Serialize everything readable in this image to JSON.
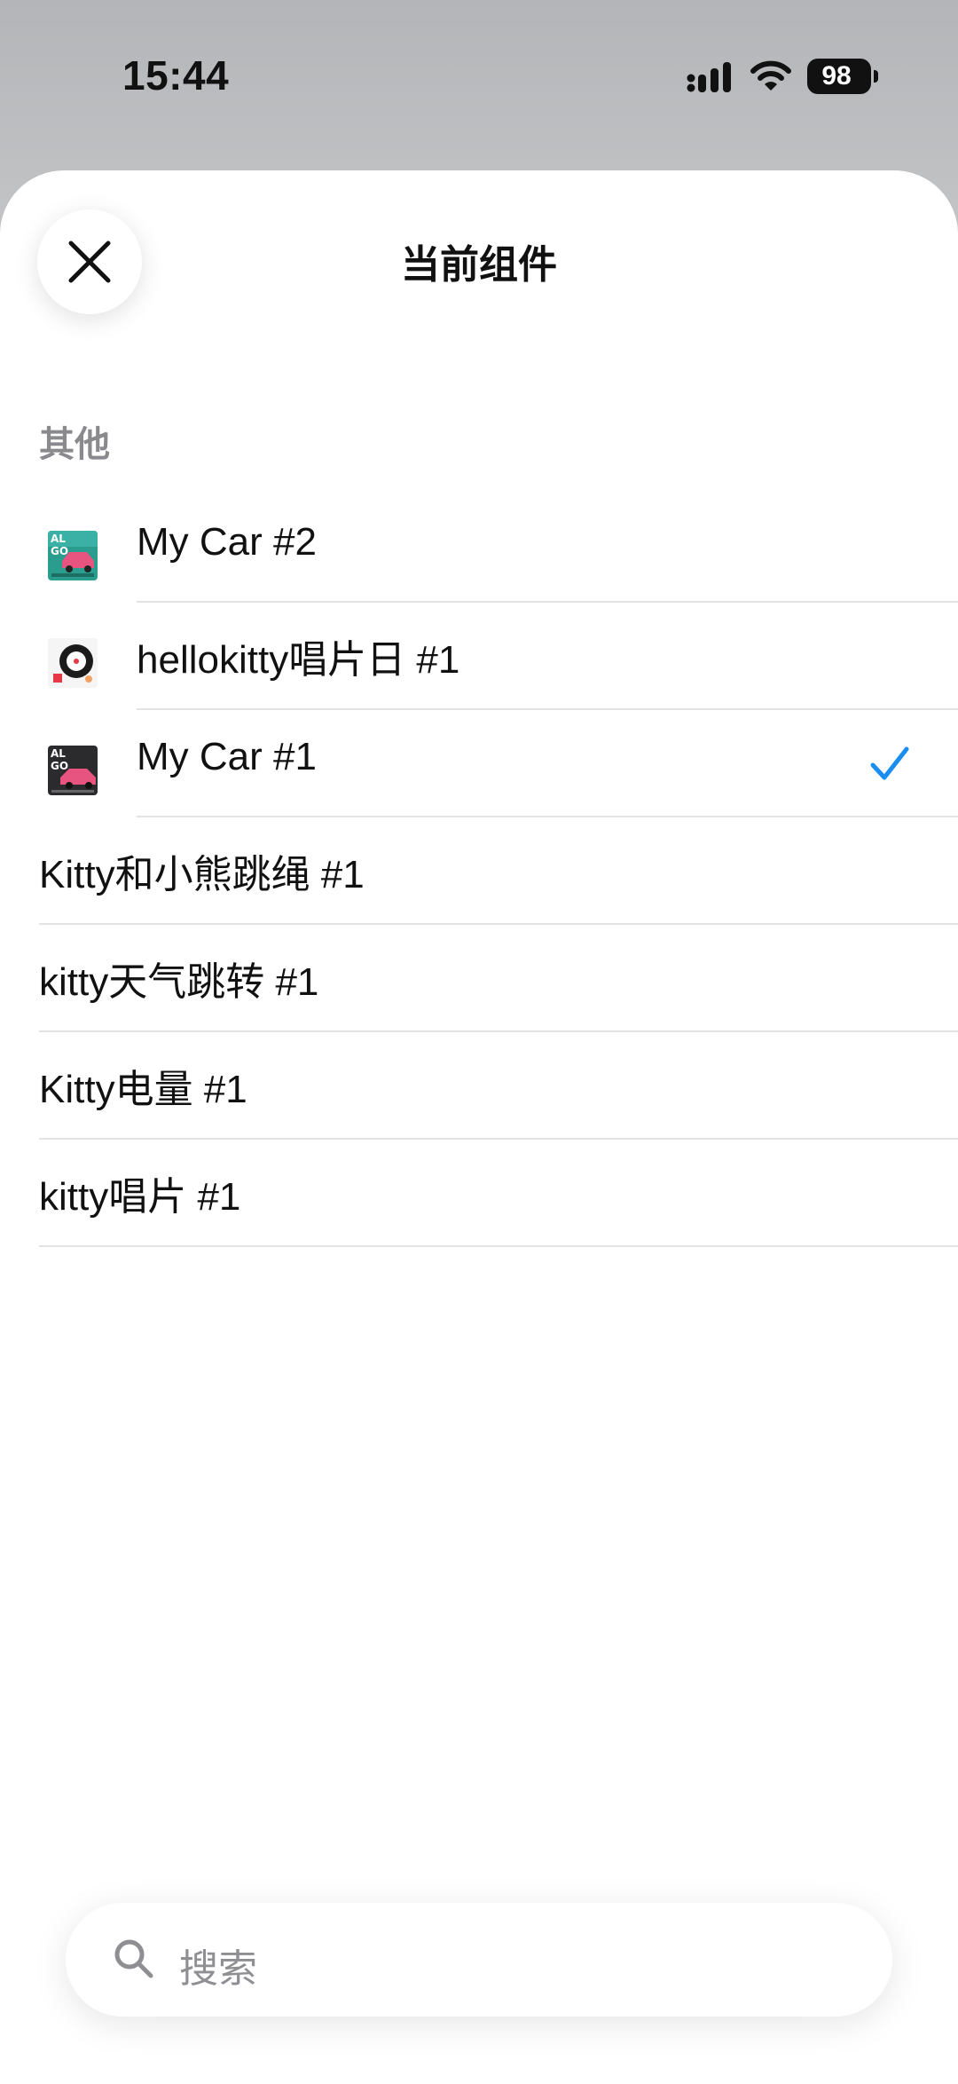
{
  "status_bar": {
    "time": "15:44",
    "battery": "98"
  },
  "sheet": {
    "title": "当前组件",
    "section_title": "其他"
  },
  "items": [
    {
      "label": "My Car #2",
      "has_thumb": true,
      "thumb": "car-pink-teal-thumbnail",
      "selected": false
    },
    {
      "label": "hellokitty唱片日 #1",
      "has_thumb": true,
      "thumb": "record-disc-thumbnail",
      "selected": false
    },
    {
      "label": "My Car #1",
      "has_thumb": true,
      "thumb": "car-dark-thumbnail",
      "selected": true
    },
    {
      "label": "Kitty和小熊跳绳 #1",
      "has_thumb": false,
      "selected": false
    },
    {
      "label": "kitty天气跳转 #1",
      "has_thumb": false,
      "selected": false
    },
    {
      "label": "Kitty电量 #1",
      "has_thumb": false,
      "selected": false
    },
    {
      "label": "kitty唱片 #1",
      "has_thumb": false,
      "selected": false
    }
  ],
  "search": {
    "placeholder": "搜索"
  },
  "colors": {
    "accent": "#1a8df0",
    "divider": "#e3e3e6",
    "section": "#8a8a8e"
  },
  "icons": {
    "close": "close-icon",
    "search": "search-icon",
    "check": "checkmark-icon"
  }
}
